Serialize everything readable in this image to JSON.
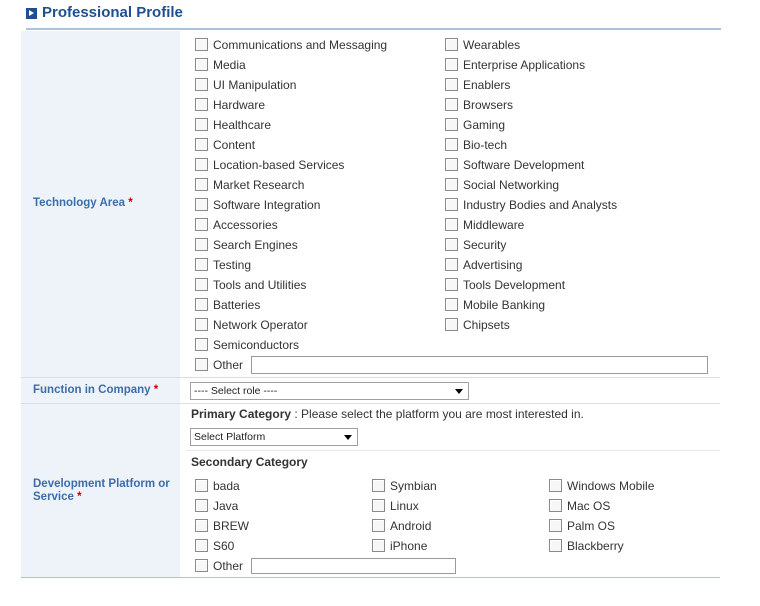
{
  "section": {
    "title": "Professional Profile"
  },
  "technology_area": {
    "label": "Technology Area",
    "required_mark": "*",
    "col1": [
      "Communications and Messaging",
      "Media",
      "UI Manipulation",
      "Hardware",
      "Healthcare",
      "Content",
      "Location-based Services",
      "Market Research",
      "Software Integration",
      "Accessories",
      "Search Engines",
      "Testing",
      "Tools and Utilities",
      "Batteries",
      "Network Operator",
      "Semiconductors"
    ],
    "col2": [
      "Wearables",
      "Enterprise Applications",
      "Enablers",
      "Browsers",
      "Gaming",
      "Bio-tech",
      "Software Development",
      "Social Networking",
      "Industry Bodies and Analysts",
      "Middleware",
      "Security",
      "Advertising",
      "Tools Development",
      "Mobile Banking",
      "Chipsets"
    ],
    "other_label": "Other",
    "other_value": ""
  },
  "function": {
    "label": "Function in Company",
    "required_mark": "*",
    "select_value": "---- Select role ----"
  },
  "platform": {
    "label": "Development Platform or Service",
    "required_mark": "*",
    "primary_label": "Primary Category",
    "primary_hint": " : Please select the platform you are most interested in.",
    "primary_select_value": "Select Platform",
    "secondary_label": "Secondary Category",
    "col1": [
      "bada",
      "Java",
      "BREW",
      "S60"
    ],
    "col2": [
      "Symbian",
      "Linux",
      "Android",
      "iPhone"
    ],
    "col3": [
      "Windows Mobile",
      "Mac OS",
      "Palm OS",
      "Blackberry"
    ],
    "other_label": "Other",
    "other_value": ""
  }
}
